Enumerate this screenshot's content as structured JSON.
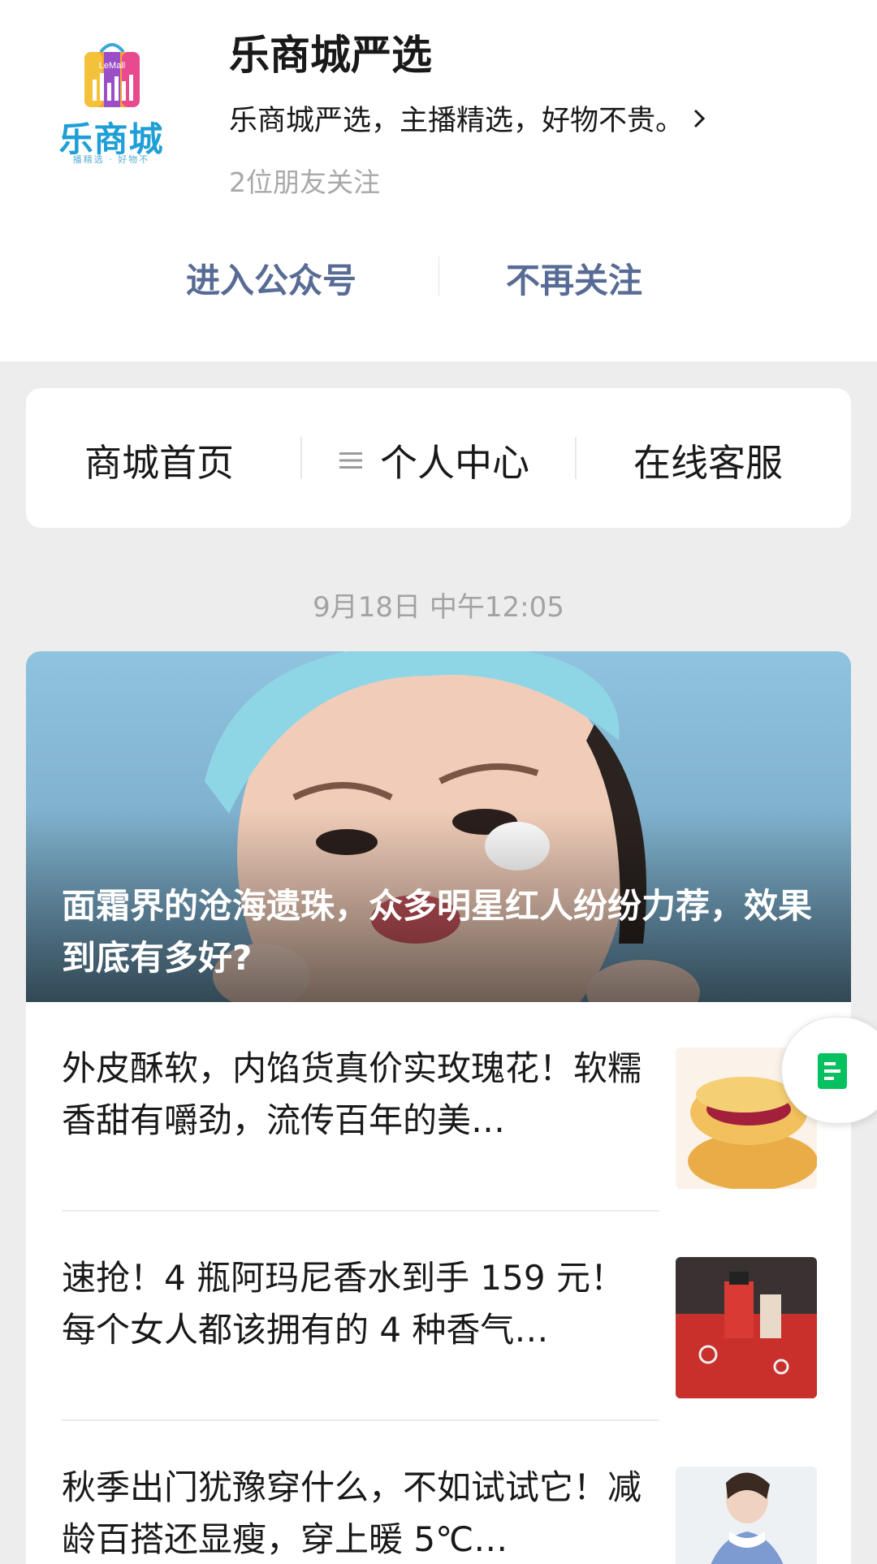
{
  "account": {
    "logo_text": "乐商城",
    "logo_wordmark": "LeMall",
    "logo_tagline": "播精选 · 好物不",
    "name": "乐商城严选",
    "description": "乐商城严选，主播精选，好物不贵。",
    "followers": "2位朋友关注",
    "enter_label": "进入公众号",
    "unfollow_label": "不再关注"
  },
  "menu": {
    "items": [
      {
        "label": "商城首页",
        "icon": null
      },
      {
        "label": "个人中心",
        "icon": "menu-lines-icon"
      },
      {
        "label": "在线客服",
        "icon": null
      }
    ]
  },
  "timestamp": "9月18日 中午12:05",
  "articles": {
    "hero": {
      "title": "面霜界的沧海遗珠，众多明星红人纷纷力荐，效果到底有多好?",
      "image": "woman-applying-face-cream"
    },
    "items": [
      {
        "title": "外皮酥软，内馅货真价实玫瑰花！软糯香甜有嚼劲，流传百年的美…",
        "thumb": "rose-pastry"
      },
      {
        "title": "速抢！4 瓶阿玛尼香水到手 159 元！每个女人都该拥有的 4 种香气…",
        "thumb": "red-perfume-box"
      },
      {
        "title": "秋季出门犹豫穿什么，不如试试它！减龄百搭还显瘦，穿上暖 5℃…",
        "thumb": "woman-knit-sweater"
      }
    ]
  },
  "floating": {
    "icon": "reader-doc-icon"
  },
  "colors": {
    "link": "#576b95",
    "muted": "#a8a8a8",
    "background": "#ededed",
    "accent_green": "#07c160"
  }
}
